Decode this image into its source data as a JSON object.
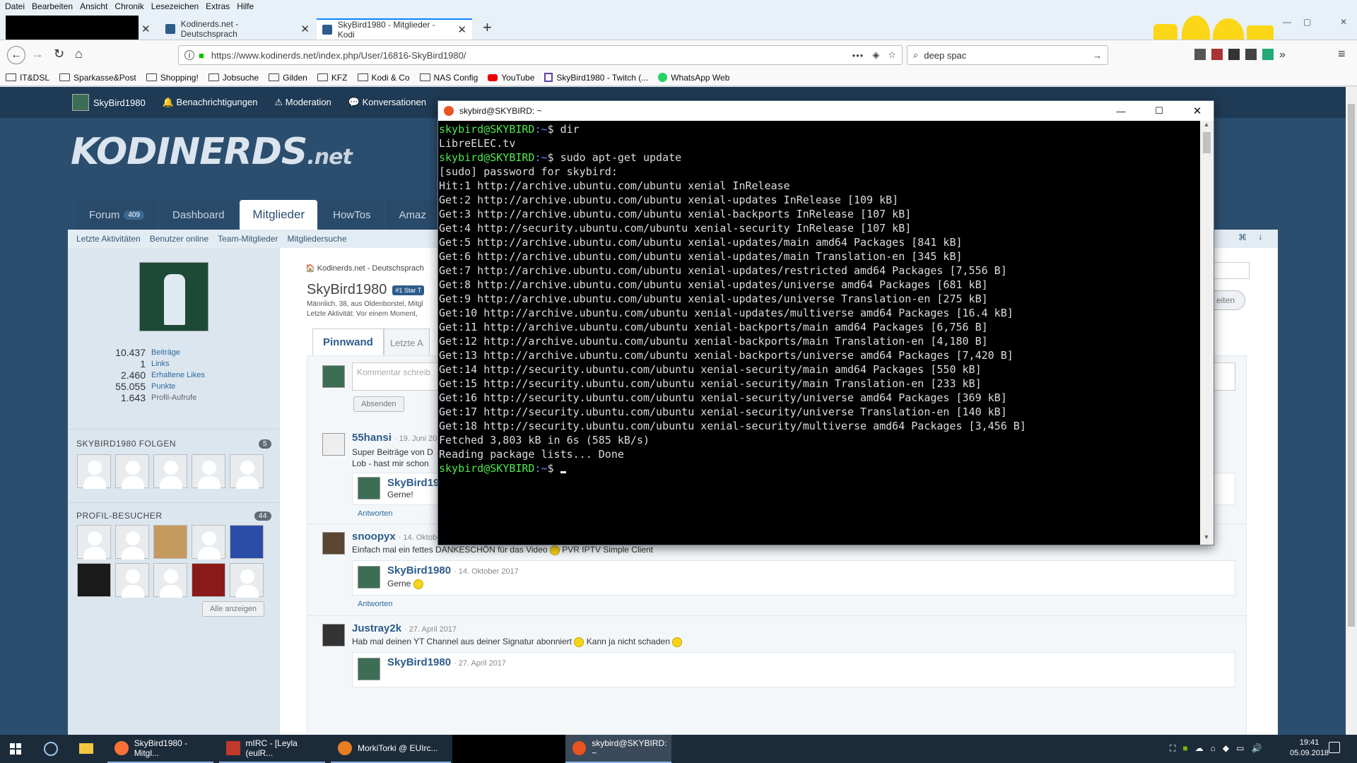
{
  "menubar": [
    "Datei",
    "Bearbeiten",
    "Ansicht",
    "Chronik",
    "Lesezeichen",
    "Extras",
    "Hilfe"
  ],
  "tabs": [
    {
      "label": "Kodinerds.net - Deutschsprach"
    },
    {
      "label": "SkyBird1980 - Mitglieder - Kodi"
    }
  ],
  "address": {
    "url": "https://www.kodinerds.net/index.php/User/16816-SkyBird1980/",
    "dots": "•••"
  },
  "search": {
    "value": "deep spac"
  },
  "bookmarks": [
    "IT&DSL",
    "Sparkasse&Post",
    "Shopping!",
    "Jobsuche",
    "Gilden",
    "KFZ",
    "Kodi & Co",
    "NAS Config",
    "YouTube",
    "SkyBird1980 - Twitch (...",
    "WhatsApp Web"
  ],
  "site": {
    "topnav": [
      "SkyBird1980",
      "Benachrichtigungen",
      "Moderation",
      "Konversationen"
    ],
    "logo": "KODINERDS",
    "logo_suffix": ".net",
    "tabs": [
      {
        "label": "Forum",
        "badge": "409"
      },
      {
        "label": "Dashboard"
      },
      {
        "label": "Mitglieder"
      },
      {
        "label": "HowTos"
      },
      {
        "label": "Amaz"
      }
    ],
    "subnav": [
      "Letzte Aktivitäten",
      "Benutzer online",
      "Team-Mitglieder",
      "Mitgliedersuche"
    ],
    "stats": [
      {
        "n": "10.437",
        "l": "Beiträge"
      },
      {
        "n": "1",
        "l": "Links"
      },
      {
        "n": "2.460",
        "l": "Erhaltene Likes"
      },
      {
        "n": "55.055",
        "l": "Punkte"
      },
      {
        "n": "1.643",
        "l": "Profil-Aufrufe"
      }
    ],
    "follow_title": "SKYBIRD1980 FOLGEN",
    "follow_count": "5",
    "visitors_title": "PROFIL-BESUCHER",
    "visitors_count": "44",
    "show_all": "Alle anzeigen",
    "breadcrumb": "Kodinerds.net - Deutschsprach",
    "username": "SkyBird1980",
    "rank": "#1 Star T",
    "userinfo": "Männlich, 38, aus Oldenborstel, Mitgl",
    "lastactivity": "Letzte Aktivität: Vor einem Moment,",
    "follow_btn": "eiten",
    "wall_tab": "Pinnwand",
    "wall_tab2": "Letzte A",
    "comment_placeholder": "Kommentar schreib",
    "send": "Absenden",
    "reply": "Antworten",
    "comments": [
      {
        "name": "55hansi",
        "date": "· 19. Juni 20",
        "text1": "Super Beiträge von D",
        "text2": "Lob - hast mir schon",
        "reply_name": "SkyBird19",
        "reply_text": "Gerne!"
      },
      {
        "name": "snoopyx",
        "date": "· 14. Oktober 2017",
        "text": "Einfach mal ein fettes DANKESCHÖN für das Video",
        "text_after": "PVR IPTV Simple Client",
        "reply_name": "SkyBird1980",
        "reply_date": "· 14. Oktober 2017",
        "reply_text": "Gerne"
      },
      {
        "name": "Justray2k",
        "date": "· 27. April 2017",
        "text": "Hab mal deinen YT Channel aus deiner Signatur abonniert",
        "text_after": "Kann ja nicht schaden",
        "reply_name": "SkyBird1980",
        "reply_date": "· 27. April 2017"
      }
    ]
  },
  "terminal": {
    "title": "skybird@SKYBIRD: ~",
    "prompt_user": "skybird@SKYBIRD",
    "prompt_path": ":~",
    "lines": [
      {
        "prompt": true,
        "cmd": "$ dir"
      },
      {
        "text": "LibreELEC.tv"
      },
      {
        "prompt": true,
        "cmd": "$ sudo apt-get update"
      },
      {
        "text": "[sudo] password for skybird:"
      },
      {
        "text": "Hit:1 http://archive.ubuntu.com/ubuntu xenial InRelease"
      },
      {
        "text": "Get:2 http://archive.ubuntu.com/ubuntu xenial-updates InRelease [109 kB]"
      },
      {
        "text": "Get:3 http://archive.ubuntu.com/ubuntu xenial-backports InRelease [107 kB]"
      },
      {
        "text": "Get:4 http://security.ubuntu.com/ubuntu xenial-security InRelease [107 kB]"
      },
      {
        "text": "Get:5 http://archive.ubuntu.com/ubuntu xenial-updates/main amd64 Packages [841 kB]"
      },
      {
        "text": "Get:6 http://archive.ubuntu.com/ubuntu xenial-updates/main Translation-en [345 kB]"
      },
      {
        "text": "Get:7 http://archive.ubuntu.com/ubuntu xenial-updates/restricted amd64 Packages [7,556 B]"
      },
      {
        "text": "Get:8 http://archive.ubuntu.com/ubuntu xenial-updates/universe amd64 Packages [681 kB]"
      },
      {
        "text": "Get:9 http://archive.ubuntu.com/ubuntu xenial-updates/universe Translation-en [275 kB]"
      },
      {
        "text": "Get:10 http://archive.ubuntu.com/ubuntu xenial-updates/multiverse amd64 Packages [16.4 kB]"
      },
      {
        "text": "Get:11 http://archive.ubuntu.com/ubuntu xenial-backports/main amd64 Packages [6,756 B]"
      },
      {
        "text": "Get:12 http://archive.ubuntu.com/ubuntu xenial-backports/main Translation-en [4,180 B]"
      },
      {
        "text": "Get:13 http://archive.ubuntu.com/ubuntu xenial-backports/universe amd64 Packages [7,420 B]"
      },
      {
        "text": "Get:14 http://security.ubuntu.com/ubuntu xenial-security/main amd64 Packages [550 kB]"
      },
      {
        "text": "Get:15 http://security.ubuntu.com/ubuntu xenial-security/main Translation-en [233 kB]"
      },
      {
        "text": "Get:16 http://security.ubuntu.com/ubuntu xenial-security/universe amd64 Packages [369 kB]"
      },
      {
        "text": "Get:17 http://security.ubuntu.com/ubuntu xenial-security/universe Translation-en [140 kB]"
      },
      {
        "text": "Get:18 http://security.ubuntu.com/ubuntu xenial-security/multiverse amd64 Packages [3,456 B]"
      },
      {
        "text": "Fetched 3,803 kB in 6s (585 kB/s)"
      },
      {
        "text": "Reading package lists... Done"
      },
      {
        "prompt": true,
        "cmd": "$ "
      }
    ]
  },
  "taskbar": {
    "items": [
      "SkyBird1980 - Mitgl...",
      "mIRC - [Leyla (eulR...",
      "MorkiTorki @ EUIrc...",
      "skybird@SKYBIRD: ~"
    ],
    "time": "19:41",
    "date": "05.09.2018"
  },
  "colors": {
    "prompt_green": "#4ee94e",
    "prompt_blue": "#6b8fff",
    "site_header": "#1f3a54"
  }
}
